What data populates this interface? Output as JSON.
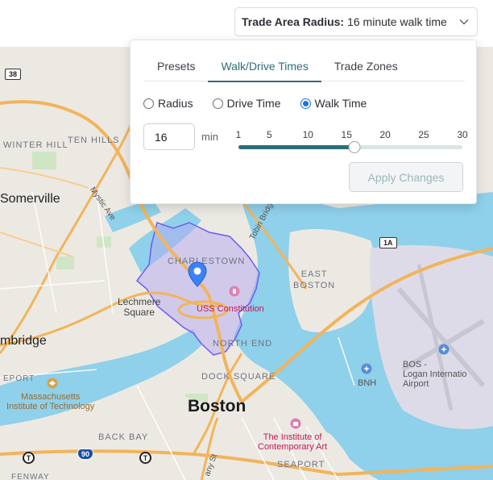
{
  "trade_area": {
    "label": "Trade Area Radius:",
    "value": "16 minute walk time"
  },
  "panel": {
    "tabs": [
      "Presets",
      "Walk/Drive Times",
      "Trade Zones"
    ],
    "active_tab": "Walk/Drive Times",
    "modes": [
      "Radius",
      "Drive Time",
      "Walk Time"
    ],
    "selected_mode": "Walk Time",
    "minutes_value": "16",
    "minutes_unit": "min",
    "slider": {
      "ticks": [
        "1",
        "5",
        "10",
        "15",
        "20",
        "25",
        "30"
      ],
      "min": 1,
      "max": 30,
      "value": 16
    },
    "apply_label": "Apply Changes"
  },
  "map": {
    "labels": {
      "winter_hill": "WINTER HILL",
      "ten_hills": "TEN HILLS",
      "mystic_ave": "Mystic Ave",
      "somerville": "Somerville",
      "tobin_bridge": "Tobin Bridge",
      "charlestown": "CHARLESTOWN",
      "east_boston": "EAST BOSTON",
      "lechmere": "Lechmere\nSquare",
      "uss_constitution": "USS Constitution",
      "cambridge": "mbridge",
      "north_end": "NORTH END",
      "eport": "EPORT",
      "mit": "Massachusetts\nInstitute of Technology",
      "dock_square": "DOCK SQUARE",
      "boston": "Boston",
      "bnh": "BNH",
      "bos": "BOS -\nLogan Internatio\nAirport",
      "back_bay": "BACK BAY",
      "ica": "The Institute of\nContemporary Art",
      "seaport": "SEAPORT",
      "fenway": "FENWAY",
      "any_st": "any St"
    },
    "shields": {
      "route_38": "38",
      "route_1a": "1A",
      "i90": "90"
    },
    "transit_icon": "T"
  },
  "colors": {
    "accent": "#2d6e79",
    "radio_selected": "#1a73e8",
    "water": "#8fd0ea",
    "isochrone_fill": "#b3a9f2",
    "isochrone_stroke": "#6f5cf0",
    "marker": "#3b82f6",
    "major_road": "#f2b45b"
  },
  "icons": {
    "dropdown": "chevron-down-icon",
    "marker": "map-pin-icon",
    "airport": "airplane-icon",
    "transit": "transit-t-icon"
  }
}
